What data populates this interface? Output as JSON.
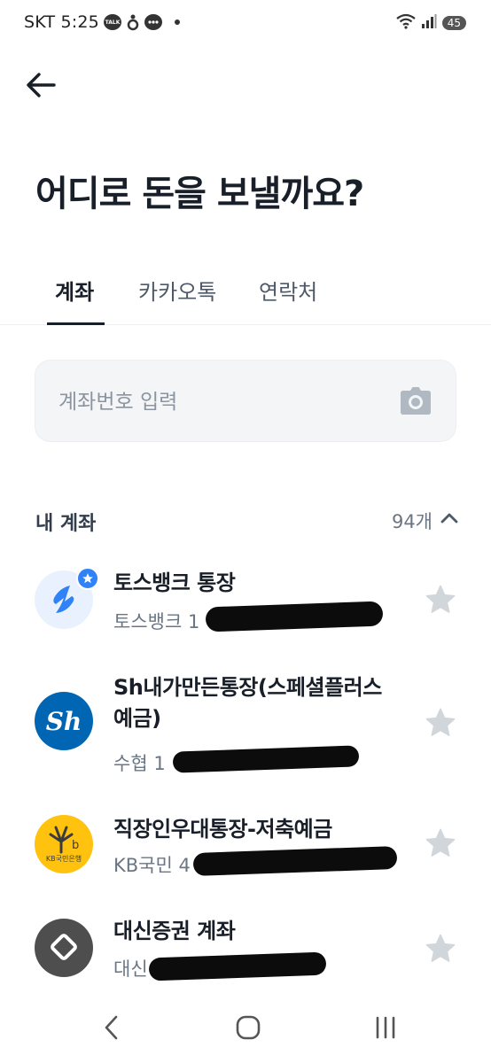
{
  "status_bar": {
    "time": "SKT 5:25",
    "talk_badge": "TALK",
    "battery": "45",
    "icons": [
      "kakaotalk-icon",
      "chat-bubble-icon",
      "wifi-icon",
      "signal-icon"
    ]
  },
  "header": {
    "back_icon": "arrow-left-icon",
    "title": "어디로 돈을 보낼까요?"
  },
  "tabs": [
    {
      "label": "계좌",
      "active": true
    },
    {
      "label": "카카오톡",
      "active": false
    },
    {
      "label": "연락처",
      "active": false
    }
  ],
  "search": {
    "placeholder": "계좌번호 입력",
    "value": "",
    "icon": "camera-icon"
  },
  "my_accounts": {
    "title": "내 계좌",
    "count": "94개",
    "toggle_icon": "chevron-up-icon",
    "items": [
      {
        "name": "토스뱅크 통장",
        "sub": "토스뱅크 1",
        "logo": "toss-bank-logo",
        "favorite": false
      },
      {
        "name": "Sh내가만든통장(스페셜플러스예금)",
        "sub": "수협 1",
        "logo": "sh-suhyup-logo",
        "logo_text": "Sh",
        "favorite": false
      },
      {
        "name": "직장인우대통장-저축예금",
        "sub": "KB국민 4",
        "logo": "kb-kookmin-logo",
        "logo_text": "KB국민은행",
        "favorite": false
      },
      {
        "name": "대신증권 계좌",
        "sub": "대신",
        "logo": "daishin-securities-logo",
        "favorite": false
      }
    ]
  },
  "colors": {
    "text_primary": "#191f28",
    "text_secondary": "#6b7684",
    "toss_blue": "#3182f6",
    "sh_blue": "#0066b3",
    "kb_yellow": "#ffc20e",
    "daishin_gray": "#4e4e4e",
    "star_gray": "#d1d6db"
  },
  "nav_bar": [
    "back-icon",
    "home-icon",
    "recents-icon"
  ]
}
